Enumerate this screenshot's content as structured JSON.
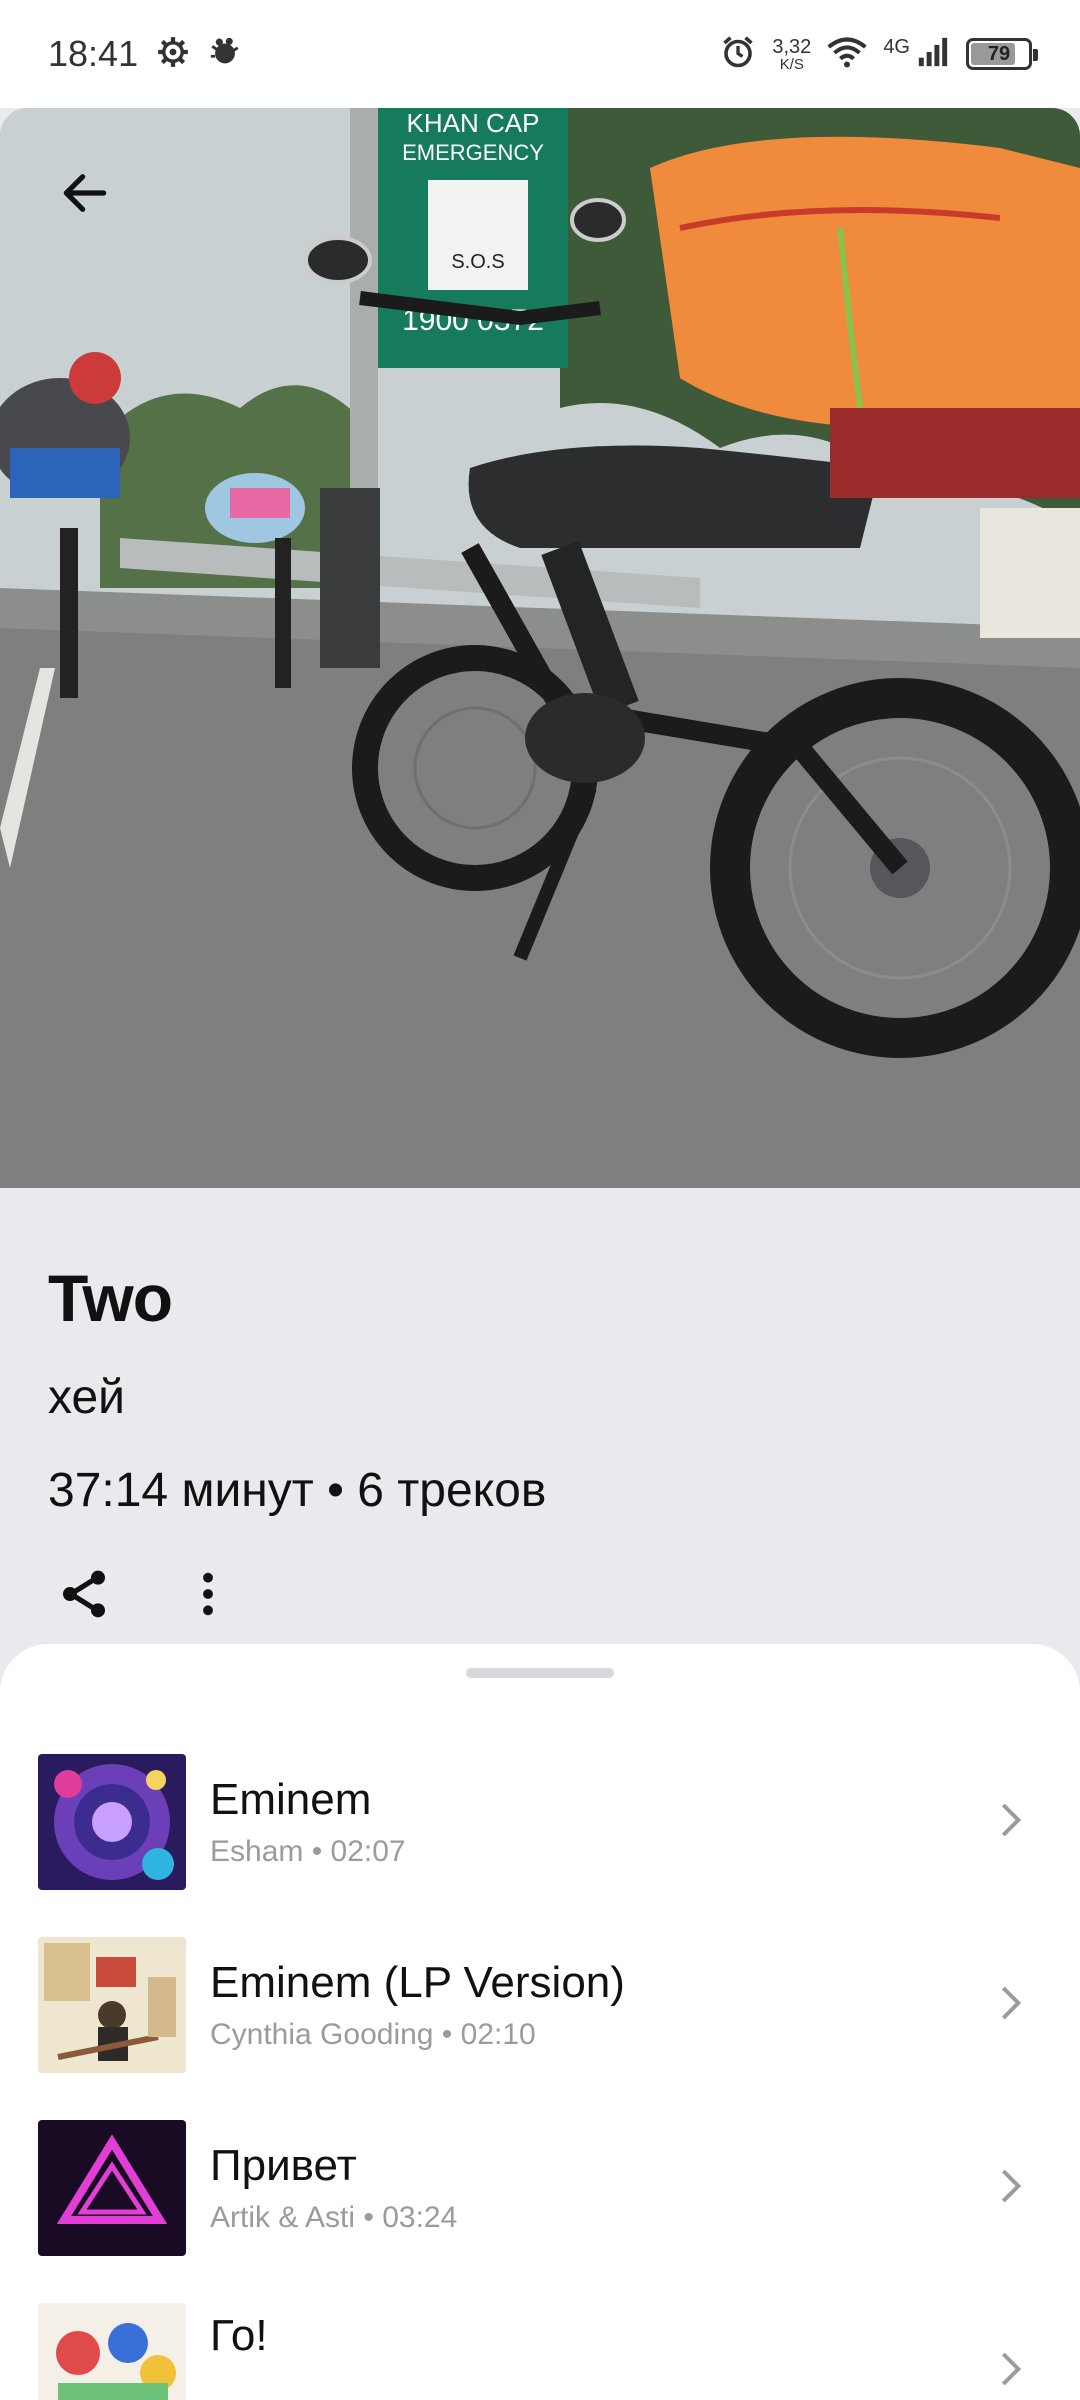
{
  "status_bar": {
    "time": "18:41",
    "net_speed_value": "3,32",
    "net_speed_unit": "K/S",
    "network_type": "4G",
    "battery_level": "79",
    "battery_fraction": 0.79
  },
  "playlist": {
    "title": "Two",
    "description": "хей",
    "meta": "37:14 минут • 6 треков"
  },
  "tracks": [
    {
      "title": "Eminem",
      "artist": "Esham",
      "duration": "02:07",
      "subline": "Esham  •  02:07"
    },
    {
      "title": "Eminem (LP Version)",
      "artist": "Cynthia Gooding",
      "duration": "02:10",
      "subline": "Cynthia Gooding  •  02:10"
    },
    {
      "title": "Привет",
      "artist": "Artik & Asti",
      "duration": "03:24",
      "subline": "Artik & Asti  •  03:24"
    },
    {
      "title": "Го!",
      "artist": "",
      "duration": "",
      "subline": ""
    }
  ],
  "icons": {
    "back": "arrow-left-icon",
    "share": "share-icon",
    "more": "more-vertical-icon",
    "chevron": "chevron-right-icon"
  },
  "colors": {
    "page_bg": "#e9e9ee",
    "sheet_bg": "#ffffff",
    "secondary_text": "#9a9a9f"
  }
}
